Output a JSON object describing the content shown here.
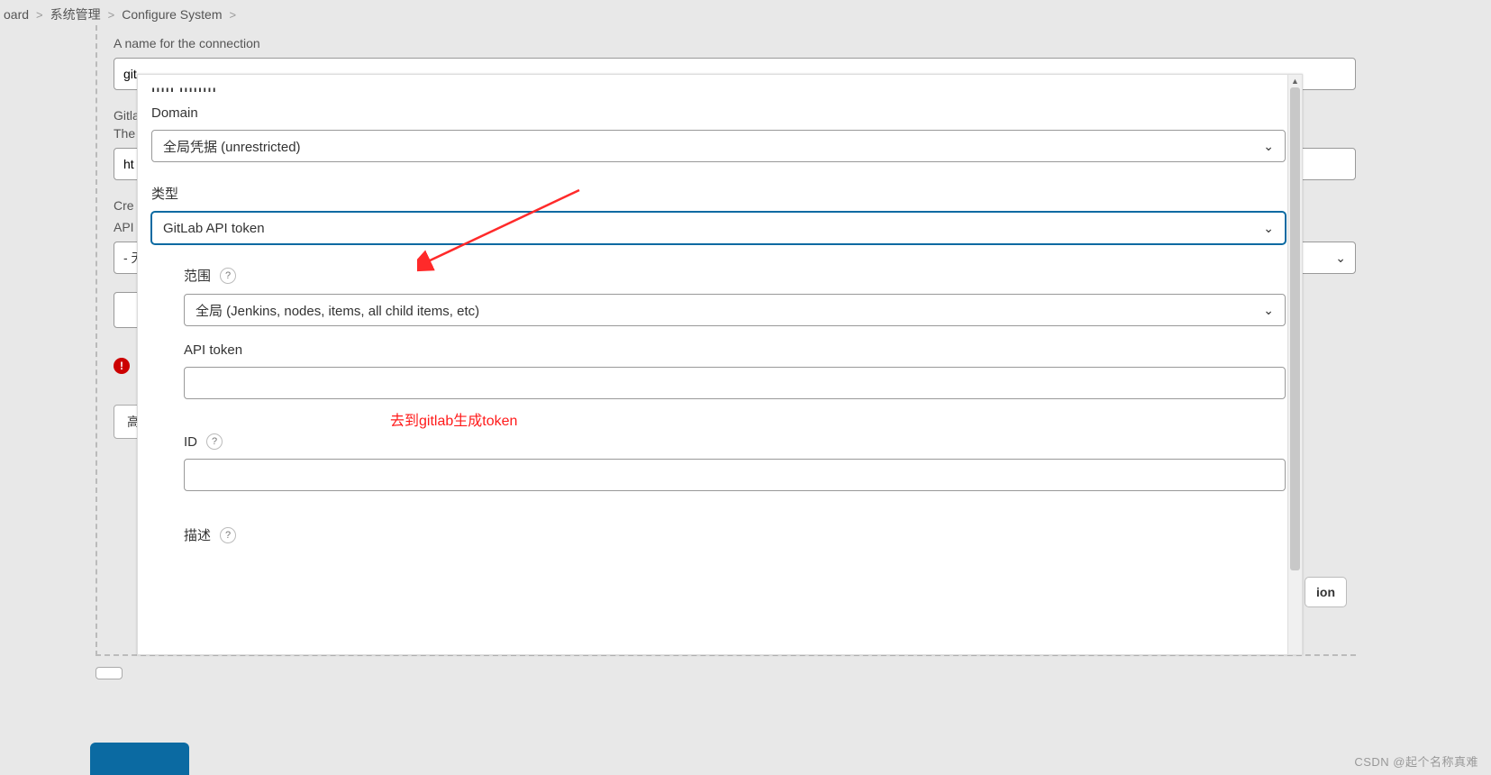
{
  "breadcrumb": {
    "item1": "oard",
    "item2": "系统管理",
    "item3": "Configure System"
  },
  "background": {
    "connName_label": "A name for the connection",
    "connName_value": "git",
    "gitlab_label": "Gitla",
    "the_label": "The",
    "http_value": "ht",
    "cred_label": "Cre",
    "api_label": "API",
    "none_option": "- 无",
    "advanced_label": "高",
    "ion_button": "ion"
  },
  "modal": {
    "header_strip": "יייייייי ייייי",
    "domain_label": "Domain",
    "domain_value": "全局凭据 (unrestricted)",
    "type_label": "类型",
    "type_value": "GitLab API token",
    "scope_label": "范围",
    "scope_value": "全局 (Jenkins, nodes, items, all child items, etc)",
    "apitoken_label": "API token",
    "apitoken_note": "去到gitlab生成token",
    "id_label": "ID",
    "desc_label": "描述"
  },
  "watermark": "CSDN @起个名称真难"
}
